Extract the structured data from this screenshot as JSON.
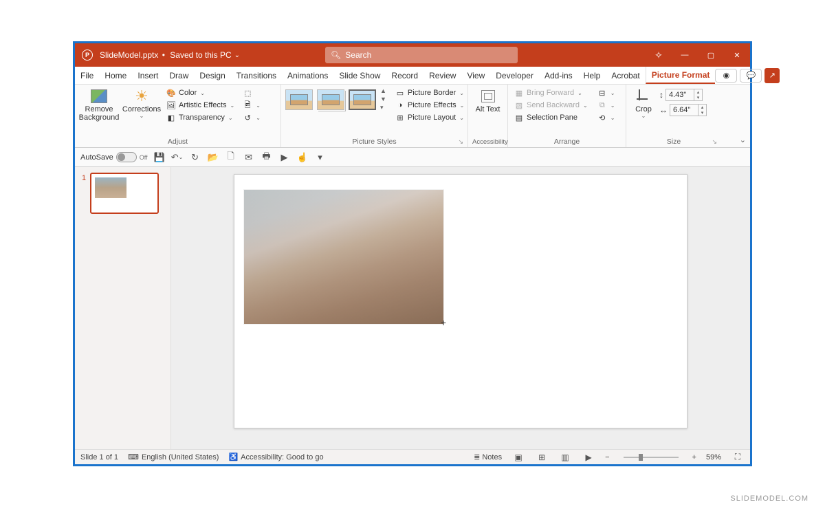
{
  "title": {
    "filename": "SlideModel.pptx",
    "save_status": "Saved to this PC"
  },
  "search": {
    "placeholder": "Search"
  },
  "tabs": [
    "File",
    "Home",
    "Insert",
    "Draw",
    "Design",
    "Transitions",
    "Animations",
    "Slide Show",
    "Record",
    "Review",
    "View",
    "Developer",
    "Add-ins",
    "Help",
    "Acrobat",
    "Picture Format"
  ],
  "active_tab": "Picture Format",
  "ribbon": {
    "adjust": {
      "remove_bg": "Remove Background",
      "corrections": "Corrections",
      "color": "Color",
      "artistic": "Artistic Effects",
      "transparency": "Transparency",
      "group_label": "Adjust"
    },
    "styles": {
      "border": "Picture Border",
      "effects": "Picture Effects",
      "layout": "Picture Layout",
      "group_label": "Picture Styles"
    },
    "accessibility": {
      "alt_text": "Alt Text",
      "group_label": "Accessibility"
    },
    "arrange": {
      "bring_forward": "Bring Forward",
      "send_backward": "Send Backward",
      "selection_pane": "Selection Pane",
      "group_label": "Arrange"
    },
    "size": {
      "crop": "Crop",
      "height": "4.43\"",
      "width": "6.64\"",
      "group_label": "Size"
    }
  },
  "qat": {
    "autosave": "AutoSave",
    "autosave_state": "Off"
  },
  "thumb": {
    "number": "1"
  },
  "status": {
    "slide": "Slide 1 of 1",
    "lang": "English (United States)",
    "access": "Accessibility: Good to go",
    "notes": "Notes",
    "zoom": "59%"
  },
  "watermark": "SLIDEMODEL.COM"
}
